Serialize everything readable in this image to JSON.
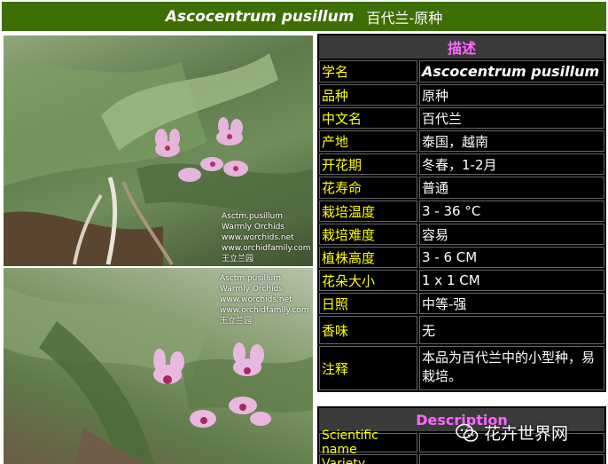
{
  "title": {
    "latin": "Ascocentrum pusillum",
    "chinese": "百代兰-原种"
  },
  "watermark": {
    "lines": [
      "Asctm.pusillum",
      "Warmly Orchids",
      "www.worchids.net",
      "www.orchidfamily.com",
      "王立兰园"
    ]
  },
  "description": {
    "header": "描述",
    "rows": [
      {
        "key": "学名",
        "value": "Ascocentrum pusillum"
      },
      {
        "key": "品种",
        "value": "原种"
      },
      {
        "key": "中文名",
        "value": "百代兰"
      },
      {
        "key": "产地",
        "value": "泰国，越南"
      },
      {
        "key": "开花期",
        "value": "冬春，1-2月"
      },
      {
        "key": "花寿命",
        "value": "普通"
      },
      {
        "key": "栽培温度",
        "value": "3 - 36 °C"
      },
      {
        "key": "栽培难度",
        "value": "容易"
      },
      {
        "key": "植株高度",
        "value": "3 - 6 CM"
      },
      {
        "key": "花朵大小",
        "value": "1 x 1 CM"
      },
      {
        "key": "日照",
        "value": "中等-强"
      },
      {
        "key": "香味",
        "value": "无"
      },
      {
        "key": "注释",
        "value": "本品为百代兰中的小型种，易栽培。"
      }
    ]
  },
  "description_en": {
    "header": "Description",
    "rows": [
      {
        "key": "Scientific name",
        "value": ""
      },
      {
        "key": "Variety",
        "value": ""
      }
    ]
  },
  "brand": {
    "text": "花卉世界网",
    "icon": "wechat-icon"
  },
  "colors": {
    "title_bg": "#3e6e06",
    "key_text": "#ffff00",
    "header_text": "#ff66ff",
    "cell_bg": "#000000"
  }
}
